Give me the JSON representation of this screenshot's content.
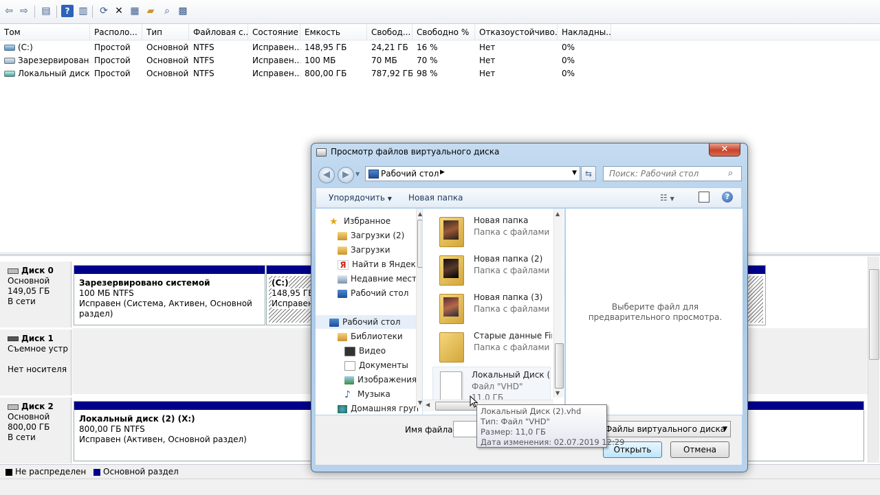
{
  "toolbar": {
    "icons": [
      "back-arrow-icon",
      "forward-arrow-icon",
      "panel-icon",
      "help-icon",
      "panel2-icon",
      "refresh-icon",
      "delete-icon",
      "properties-icon",
      "open-icon",
      "search-icon",
      "settings-icon"
    ]
  },
  "volumes": {
    "columns": [
      "Том",
      "Располо...",
      "Тип",
      "Файловая с...",
      "Состояние",
      "Емкость",
      "Свобод...",
      "Свободно %",
      "Отказоустойчиво...",
      "Накладны..."
    ],
    "rows": [
      {
        "name": "(C:)",
        "layout": "Простой",
        "type": "Основной",
        "fs": "NTFS",
        "state": "Исправен...",
        "capacity": "148,95 ГБ",
        "free": "24,21 ГБ",
        "free_pct": "16 %",
        "fault": "Нет",
        "overhead": "0%",
        "icon": "blue"
      },
      {
        "name": "Зарезервирован...",
        "layout": "Простой",
        "type": "Основной",
        "fs": "NTFS",
        "state": "Исправен...",
        "capacity": "100 МБ",
        "free": "70 МБ",
        "free_pct": "70 %",
        "fault": "Нет",
        "overhead": "0%",
        "icon": "gray"
      },
      {
        "name": "Локальный диск ...",
        "layout": "Простой",
        "type": "Основной",
        "fs": "NTFS",
        "state": "Исправен...",
        "capacity": "800,00 ГБ",
        "free": "787,92 ГБ",
        "free_pct": "98 %",
        "fault": "Нет",
        "overhead": "0%",
        "icon": "teal"
      }
    ]
  },
  "disks": [
    {
      "name": "Диск 0",
      "type": "Основной",
      "size": "149,05 ГБ",
      "status": "В сети",
      "part1": {
        "title": "Зарезервировано системой",
        "line2": "100 МБ NTFS",
        "line3": "Исправен (Система, Активен, Основной раздел)"
      },
      "part2": {
        "title": "(C:)",
        "line2": "148,95 ГБ",
        "line3": "Исправен"
      }
    },
    {
      "name": "Диск 1",
      "type": "Съемное устрой",
      "size": "",
      "status": "Нет носителя"
    },
    {
      "name": "Диск 2",
      "type": "Основной",
      "size": "800,00 ГБ",
      "status": "В сети",
      "part1": {
        "title": "Локальный диск (2)  (X:)",
        "line2": "800,00 ГБ NTFS",
        "line3": "Исправен (Активен, Основной раздел)"
      }
    }
  ],
  "legend": {
    "unallocated": "Не распределен",
    "primary": "Основной раздел",
    "unallocated_color": "#000000",
    "primary_color": "#00008b"
  },
  "dialog": {
    "title": "Просмотр файлов виртуального диска",
    "close": "✕",
    "address": "Рабочий стол",
    "search_placeholder": "Поиск: Рабочий стол",
    "organize": "Упорядочить",
    "new_folder": "Новая папка",
    "nav": {
      "favorites": "Избранное",
      "downloads2": "Загрузки (2)",
      "downloads": "Загрузки",
      "yandex": "Найти в Яндексе",
      "recent": "Недавние места",
      "desktop_fav": "Рабочий стол",
      "desktop": "Рабочий стол",
      "libraries": "Библиотеки",
      "video": "Видео",
      "documents": "Документы",
      "images": "Изображения",
      "music": "Музыка",
      "homegroup": "Домашняя груп"
    },
    "files": [
      {
        "name": "Новая папка",
        "desc": "Папка с файлами"
      },
      {
        "name": "Новая папка (2)",
        "desc": "Папка с файлами"
      },
      {
        "name": "Новая папка (3)",
        "desc": "Папка с файлами"
      },
      {
        "name": "Старые данные Firefox",
        "desc": "Папка с файлами"
      },
      {
        "name": "Локальный Диск (2).vhd",
        "desc": "Файл \"VHD\"",
        "size": "11,0 ГБ"
      }
    ],
    "preview_text": "Выберите файл для предварительного просмотра.",
    "filename_label": "Имя файла:",
    "filetype": "Файлы виртуального диска",
    "open": "Открыть",
    "cancel": "Отмена"
  },
  "tooltip": {
    "line1": "Локальный Диск (2).vhd",
    "line2": "Тип: Файл \"VHD\"",
    "line3": "Размер: 11,0 ГБ",
    "line4": "Дата изменения: 02.07.2019 12:29"
  }
}
